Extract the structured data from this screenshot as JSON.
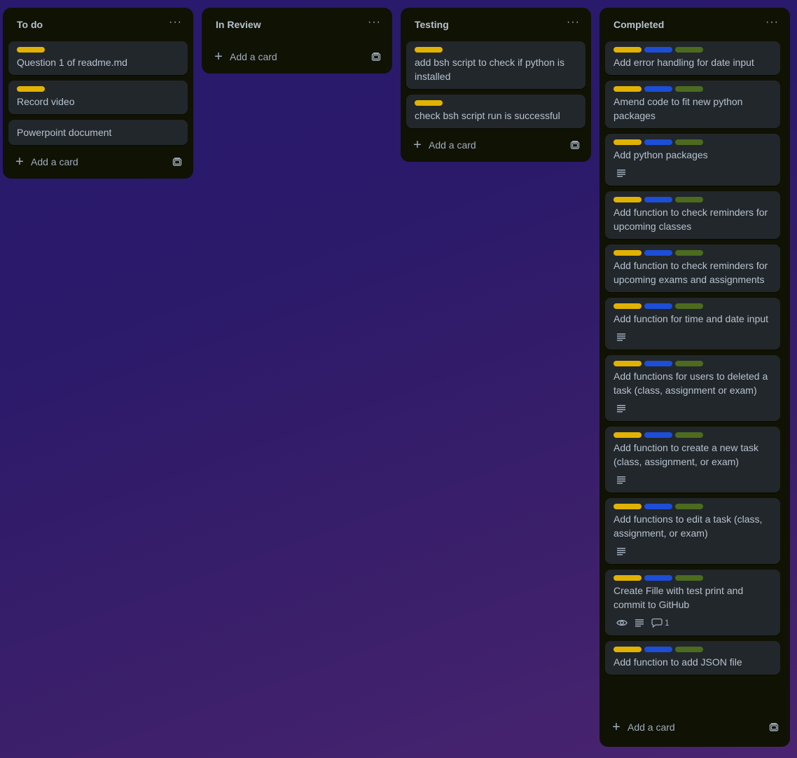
{
  "colors": {
    "label_yellow": "#e2b203",
    "label_blue": "#1d4ed8",
    "label_green": "#4c6b1f"
  },
  "common": {
    "add_card_label": "Add a card",
    "menu_icon": "more-horizontal-icon",
    "template_icon": "card-template-icon"
  },
  "lists": {
    "todo": {
      "title": "To do",
      "cards": [
        {
          "title": "Question 1 of readme.md",
          "labels": [
            "yellow"
          ]
        },
        {
          "title": "Record video",
          "labels": [
            "yellow"
          ]
        },
        {
          "title": "Powerpoint document",
          "labels": []
        }
      ]
    },
    "review": {
      "title": "In Review",
      "cards": []
    },
    "testing": {
      "title": "Testing",
      "cards": [
        {
          "title": "add bsh script to check if python is installed",
          "labels": [
            "yellow"
          ]
        },
        {
          "title": "check bsh script run is successful",
          "labels": [
            "yellow"
          ]
        }
      ]
    },
    "completed": {
      "title": "Completed",
      "cards": [
        {
          "title": "Add error handling for date input",
          "labels": [
            "yellow",
            "blue",
            "green"
          ]
        },
        {
          "title": "Amend code to fit new python packages",
          "labels": [
            "yellow",
            "blue",
            "green"
          ]
        },
        {
          "title": "Add python packages",
          "labels": [
            "yellow",
            "blue",
            "green"
          ],
          "badges": [
            "description-icon"
          ]
        },
        {
          "title": "Add function to check reminders for upcoming classes",
          "labels": [
            "yellow",
            "blue",
            "green"
          ]
        },
        {
          "title": "Add function to check reminders for upcoming exams and assignments",
          "labels": [
            "yellow",
            "blue",
            "green"
          ]
        },
        {
          "title": "Add function for time and date input",
          "labels": [
            "yellow",
            "blue",
            "green"
          ],
          "badges": [
            "description-icon"
          ]
        },
        {
          "title": "Add functions for users to deleted a task (class, assignment or exam)",
          "labels": [
            "yellow",
            "blue",
            "green"
          ],
          "badges": [
            "description-icon"
          ]
        },
        {
          "title": "Add function to create a new task (class, assignment, or exam)",
          "labels": [
            "yellow",
            "blue",
            "green"
          ],
          "badges": [
            "description-icon"
          ]
        },
        {
          "title": "Add functions to edit a task (class, assignment, or exam)",
          "labels": [
            "yellow",
            "blue",
            "green"
          ],
          "badges": [
            "description-icon"
          ]
        },
        {
          "title": "Create Fille with test print and commit to GitHub",
          "labels": [
            "yellow",
            "blue",
            "green"
          ],
          "badges": [
            "watch-icon",
            "description-icon",
            "comment-icon"
          ],
          "comment_count": "1"
        },
        {
          "title": "Add function to add JSON file",
          "labels": [
            "yellow",
            "blue",
            "green"
          ]
        }
      ]
    }
  }
}
